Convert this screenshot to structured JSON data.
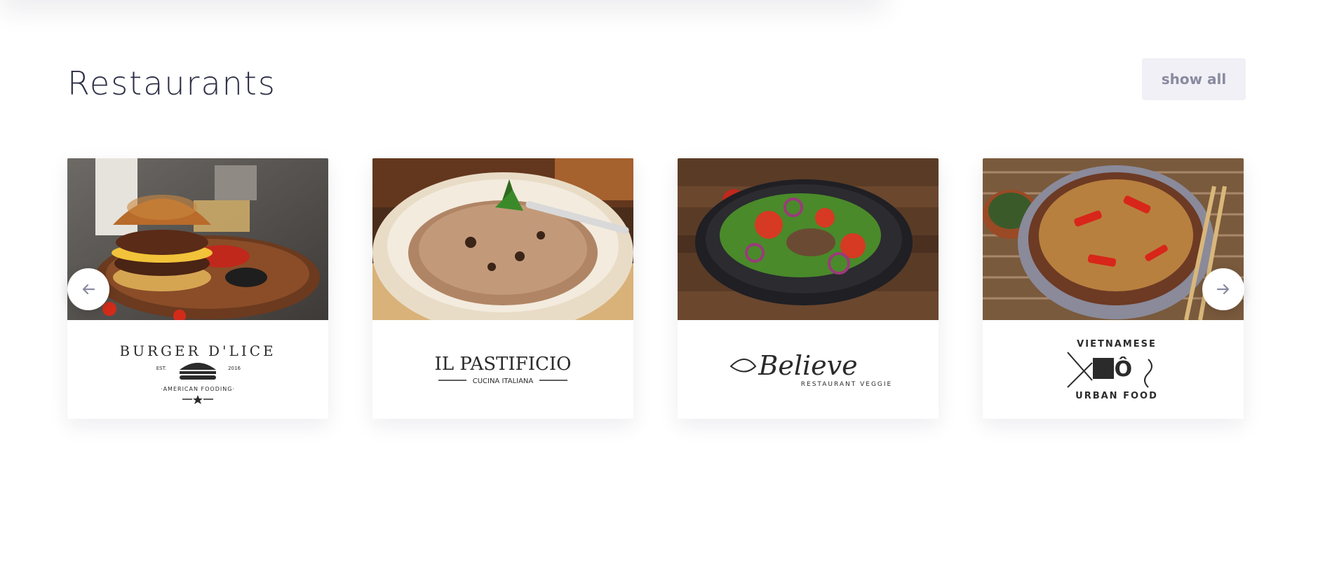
{
  "section": {
    "title": "Restaurants",
    "show_all_label": "show all"
  },
  "carousel": {
    "prev_icon": "arrow-left-icon",
    "next_icon": "arrow-right-icon",
    "items": [
      {
        "photo": "burger-photo",
        "logo": {
          "line1": "BURGER D'LICE",
          "est": "EST.",
          "year": "2016",
          "tagline": "·AMERICAN FOODING·"
        }
      },
      {
        "photo": "risotto-photo",
        "logo": {
          "line1": "IL PASTIFICIO",
          "tagline": "CUCINA ITALIANA"
        }
      },
      {
        "photo": "salad-photo",
        "logo": {
          "line1": "Believe",
          "tagline": "RESTAURANT VEGGIE"
        }
      },
      {
        "photo": "stirfry-photo",
        "logo": {
          "top": "VIETNAMESE",
          "mark": "BÔ",
          "bottom": "URBAN FOOD"
        }
      }
    ]
  },
  "colors": {
    "title": "#2e3047",
    "button_bg": "#f0f0f6",
    "button_text": "#8a8aa0",
    "arrow": "#8a8aa0"
  }
}
